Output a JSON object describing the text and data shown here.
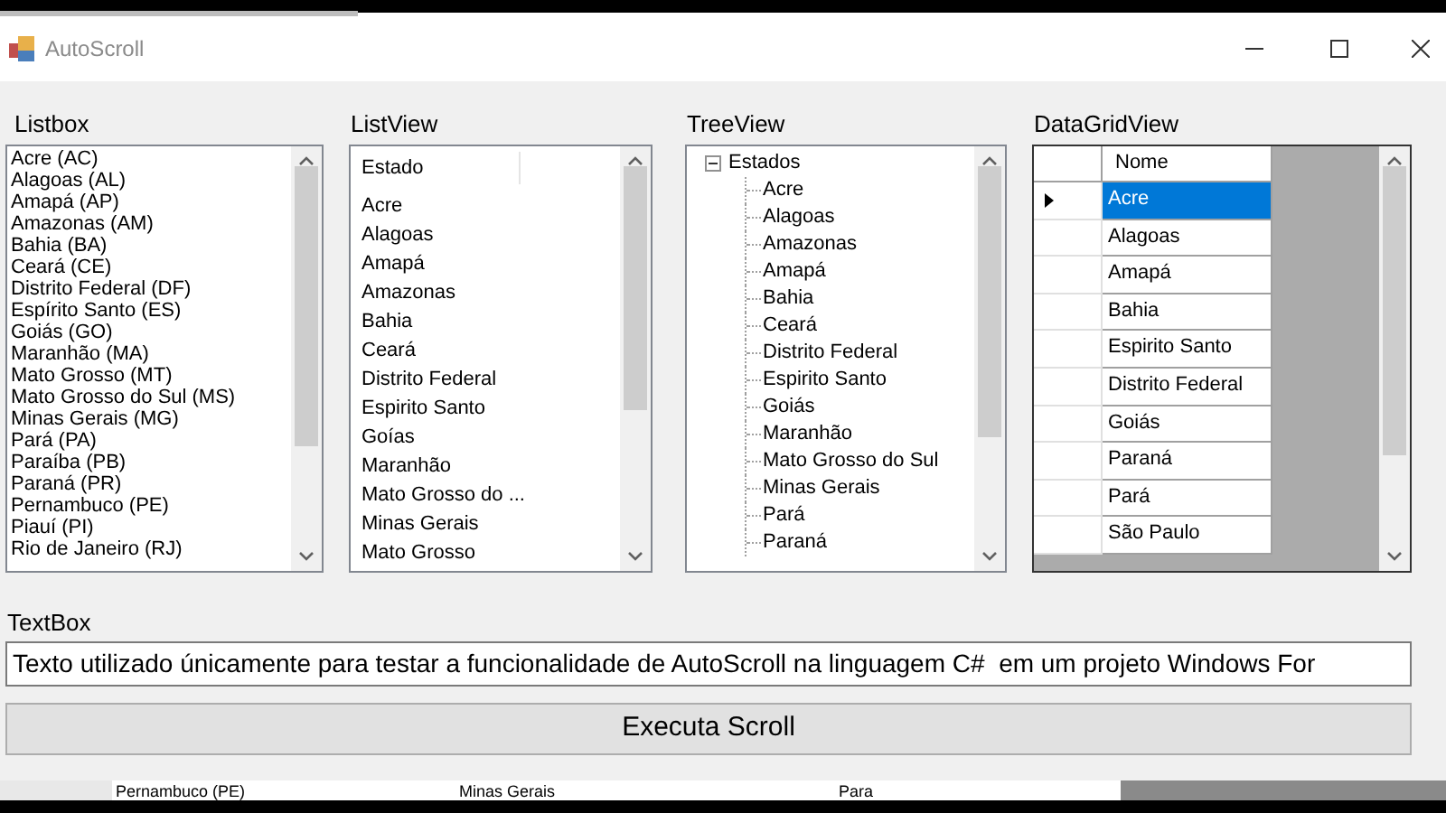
{
  "window": {
    "title": "AutoScroll"
  },
  "listbox": {
    "label": "Listbox",
    "items": [
      "Acre (AC)",
      "Alagoas (AL)",
      "Amapá (AP)",
      "Amazonas (AM)",
      "Bahia (BA)",
      "Ceará (CE)",
      "Distrito Federal (DF)",
      "Espírito Santo (ES)",
      "Goiás (GO)",
      "Maranhão (MA)",
      "Mato Grosso (MT)",
      "Mato Grosso do Sul (MS)",
      "Minas Gerais (MG)",
      "Pará (PA)",
      "Paraíba (PB)",
      "Paraná (PR)",
      "Pernambuco (PE)",
      "Piauí (PI)",
      "Rio de Janeiro (RJ)"
    ]
  },
  "listview": {
    "label": "ListView",
    "column": "Estado",
    "items": [
      "Acre",
      "Alagoas",
      "Amapá",
      "Amazonas",
      "Bahia",
      "Ceará",
      "Distrito Federal",
      "Espirito Santo",
      "Goías",
      "Maranhão",
      "Mato Grosso do ...",
      "Minas Gerais",
      "Mato Grosso"
    ]
  },
  "treeview": {
    "label": "TreeView",
    "root": {
      "label": "Estados",
      "expanded": true,
      "children": [
        "Acre",
        "Alagoas",
        "Amazonas",
        "Amapá",
        "Bahia",
        "Ceará",
        "Distrito Federal",
        "Espirito Santo",
        "Goiás",
        "Maranhão",
        "Mato Grosso do Sul",
        "Minas Gerais",
        "Pará",
        "Paraná"
      ]
    }
  },
  "datagridview": {
    "label": "DataGridView",
    "column": "Nome",
    "rows": [
      {
        "value": "Acre",
        "selected": true
      },
      {
        "value": "Alagoas",
        "selected": false
      },
      {
        "value": "Amapá",
        "selected": false
      },
      {
        "value": "Bahia",
        "selected": false
      },
      {
        "value": "Espirito Santo",
        "selected": false
      },
      {
        "value": "Distrito Federal",
        "selected": false
      },
      {
        "value": "Goiás",
        "selected": false
      },
      {
        "value": "Paraná",
        "selected": false
      },
      {
        "value": "Pará",
        "selected": false
      },
      {
        "value": "São Paulo",
        "selected": false
      }
    ]
  },
  "textbox": {
    "label": "TextBox",
    "value": "Texto utilizado únicamente para testar a funcionalidade de AutoScroll na linguagem C#  em um projeto Windows For"
  },
  "button": "Executa Scroll",
  "behind": [
    "Pernambuco (PE)",
    "Minas Gerais",
    "Para"
  ]
}
